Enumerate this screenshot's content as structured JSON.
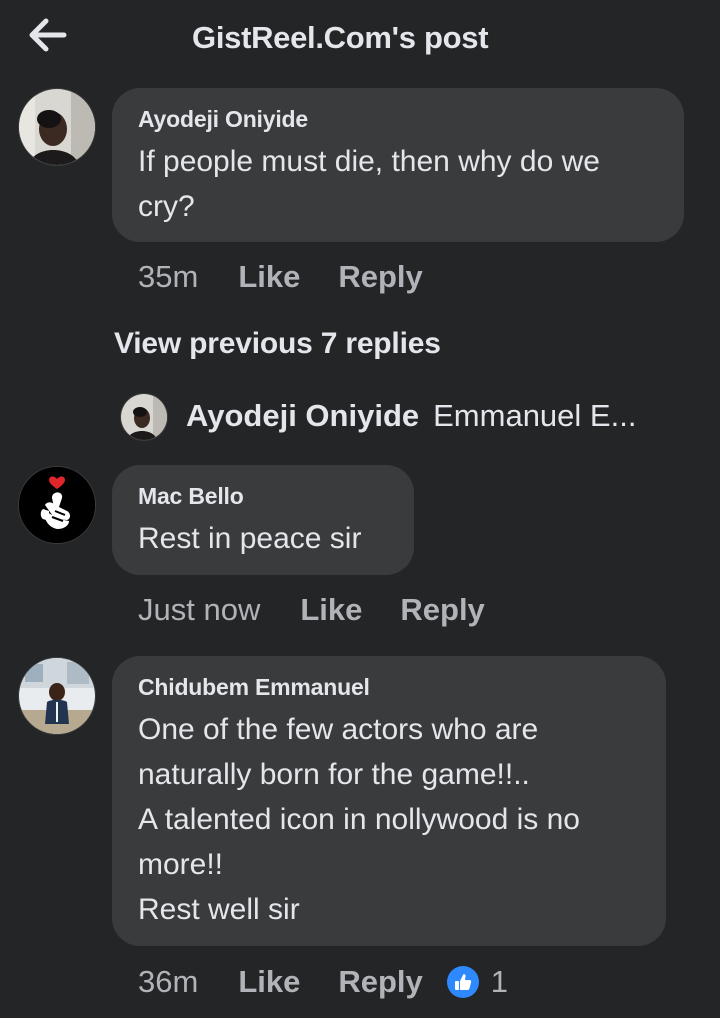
{
  "header": {
    "title": "GistReel.Com's post",
    "back_icon": "arrow-left-icon"
  },
  "comments": [
    {
      "author": "Ayodeji Oniyide",
      "text": "If people must die, then why do we cry?",
      "time": "35m",
      "like_label": "Like",
      "reply_label": "Reply"
    },
    {
      "author": "Mac Bello",
      "text": "Rest in peace sir",
      "time": "Just now",
      "like_label": "Like",
      "reply_label": "Reply"
    },
    {
      "author": "Chidubem Emmanuel",
      "text_lines": [
        "One of the few actors who are",
        "naturally born for the game!!..",
        "A talented icon in nollywood is no",
        "more!!",
        "Rest well sir"
      ],
      "time": "36m",
      "like_label": "Like",
      "reply_label": "Reply",
      "reaction_icon": "thumbs-up-icon",
      "reaction_count": "1"
    }
  ],
  "thread": {
    "view_previous": "View previous 7 replies",
    "reply_preview": {
      "author": "Ayodeji Oniyide",
      "text": "Emmanuel E..."
    }
  },
  "colors": {
    "background": "#242526",
    "bubble": "#3a3b3c",
    "primary_text": "#e4e6eb",
    "secondary_text": "#b0b3b8",
    "like_blue": "#2e89ff"
  }
}
